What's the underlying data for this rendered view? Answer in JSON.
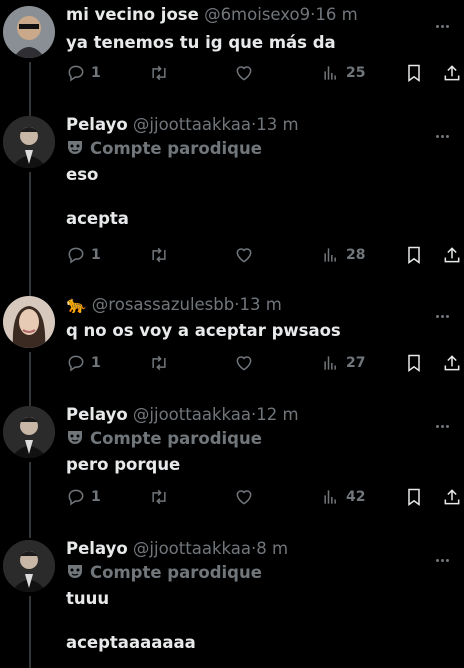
{
  "tweets": [
    {
      "name": "mi vecino jose",
      "handle": "@6moisexo9",
      "time": "16 m",
      "parody": "",
      "text": "ya tenemos tu ig que más da",
      "replies": "1",
      "views": "25"
    },
    {
      "name": "Pelayo",
      "handle": "@jjoottaakkaa",
      "time": "13 m",
      "parody": "Compte parodique",
      "text": "eso\n\nacepta",
      "replies": "1",
      "views": "28"
    },
    {
      "name": "🐆",
      "handle": "@rosassazulesbb",
      "time": "13 m",
      "parody": "",
      "text": "q no os voy a aceptar pwsaos",
      "replies": "1",
      "views": "27"
    },
    {
      "name": "Pelayo",
      "handle": "@jjoottaakkaa",
      "time": "12 m",
      "parody": "Compte parodique",
      "text": "pero porque",
      "replies": "1",
      "views": "42"
    },
    {
      "name": "Pelayo",
      "handle": "@jjoottaakkaa",
      "time": "8 m",
      "parody": "Compte parodique",
      "text": "tuuu\n\naceptaaaaaaa",
      "replies": "",
      "views": ""
    }
  ],
  "separator": "·",
  "icons": {
    "reply": "reply-icon",
    "retweet": "retweet-icon",
    "like": "heart-icon",
    "views": "views-icon",
    "bookmark": "bookmark-icon",
    "share": "share-icon",
    "more": "more-icon",
    "parody": "parody-mask-icon"
  },
  "colors": {
    "background": "#000000",
    "text": "#e7e9ea",
    "muted": "#71767b",
    "line": "#333639"
  }
}
